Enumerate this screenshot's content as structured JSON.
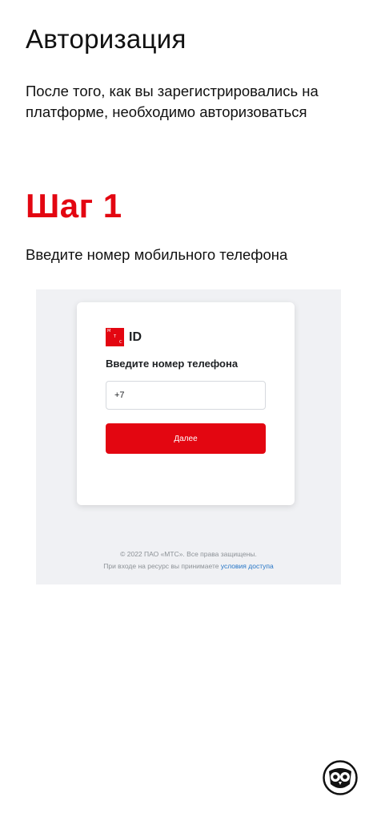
{
  "page": {
    "title": "Авторизация",
    "intro": "После того, как вы зарегистрировались на платформе, необходимо авторизоваться",
    "step": "Шаг 1",
    "instruction": "Введите номер мобильного телефона"
  },
  "screenshot": {
    "logo": {
      "letters": [
        "М",
        "Т",
        "С"
      ],
      "id": "ID"
    },
    "heading": "Введите номер телефона",
    "phone_input": {
      "value": "+7"
    },
    "next_button": "Далее",
    "footer": {
      "copyright": "© 2022 ПАО «МТС». Все права защищены.",
      "terms_prefix": "При входе на ресурс вы принимаете",
      "terms_link": "условия доступа"
    }
  },
  "icons": {
    "corner_logo": "owl-icon"
  },
  "colors": {
    "accent": "#e30611",
    "link": "#2575c6",
    "panel_bg": "#f0f1f4"
  }
}
